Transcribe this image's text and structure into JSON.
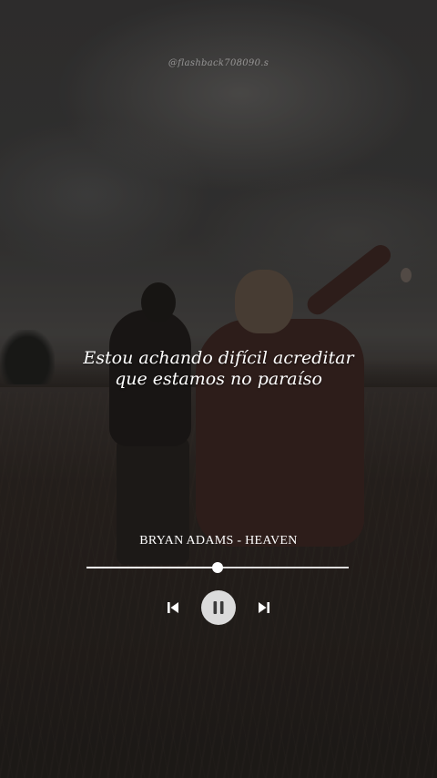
{
  "watermark": "@flashback708090.s",
  "lyrics": {
    "line1": "Estou achando difícil acreditar",
    "line2": "que estamos no paraíso"
  },
  "track": {
    "title": "BRYAN ADAMS - HEAVEN",
    "progress_fraction": 0.5
  },
  "controls": {
    "previous_icon": "skip-previous-icon",
    "pause_icon": "pause-icon",
    "next_icon": "skip-next-icon"
  },
  "colors": {
    "text": "#ffffff",
    "pause_button_bg": "#ebebeb",
    "icon_dark": "#3a3a3a"
  }
}
